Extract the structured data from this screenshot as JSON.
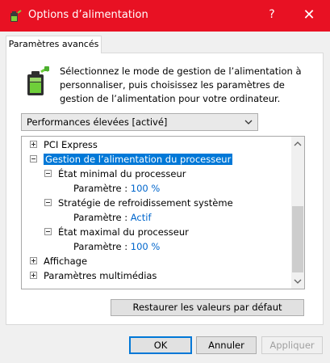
{
  "window": {
    "title": "Options d’alimentation",
    "help": "?",
    "close": "✕"
  },
  "tab": {
    "label": "Paramètres avancés"
  },
  "description": "Sélectionnez le mode de gestion de l’alimentation à personnaliser, puis choisissez les paramètres de gestion de l’alimentation pour votre ordinateur.",
  "plan_select": {
    "value": "Performances élevées [activé]"
  },
  "tree": {
    "pci_express": "PCI Express",
    "processor_mgmt": "Gestion de l’alimentation du processeur",
    "min_state": "État minimal du processeur",
    "min_param_label": "Paramètre :",
    "min_param_value": "100  %",
    "cooling": "Stratégie de refroidissement système",
    "cooling_param_label": "Paramètre :",
    "cooling_param_value": "Actif",
    "max_state": "État maximal du processeur",
    "max_param_label": "Paramètre :",
    "max_param_value": "100  %",
    "display": "Affichage",
    "multimedia": "Paramètres multimédias"
  },
  "buttons": {
    "restore": "Restaurer les valeurs par défaut",
    "ok": "OK",
    "cancel": "Annuler",
    "apply": "Appliquer"
  },
  "colors": {
    "titlebar": "#e81123",
    "selection": "#0078d7",
    "value_text": "#0066cc"
  },
  "icons": [
    "power-app-icon",
    "battery-plug-icon",
    "chevron-down-icon",
    "expand-icon",
    "collapse-icon",
    "scroll-up-icon",
    "scroll-down-icon",
    "help-icon",
    "close-icon"
  ]
}
